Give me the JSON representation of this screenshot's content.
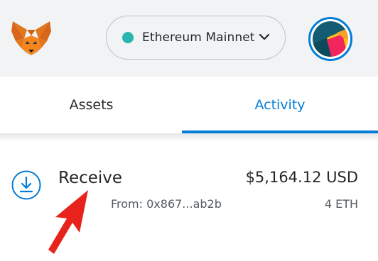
{
  "header": {
    "network": {
      "label": "Ethereum Mainnet",
      "dot_color": "#29b6af"
    },
    "logo_icon": "metamask-fox-icon",
    "avatar_icon": "jazzicon-avatar"
  },
  "tabs": [
    {
      "label": "Assets",
      "active": false
    },
    {
      "label": "Activity",
      "active": true
    }
  ],
  "activity": {
    "items": [
      {
        "icon": "receive-icon",
        "title": "Receive",
        "from": "From: 0x867...ab2b",
        "fiat_amount": "$5,164.12 USD",
        "token_amount": "4 ETH"
      }
    ]
  },
  "colors": {
    "accent": "#037dd6",
    "header_bg": "#f2f3f4",
    "annotation_arrow": "#e8231b"
  }
}
